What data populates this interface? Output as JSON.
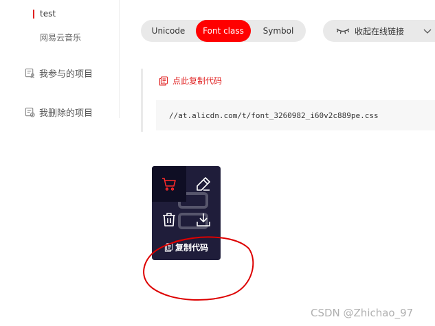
{
  "sidebar": {
    "items": [
      {
        "label": "test"
      },
      {
        "label": "网易云音乐"
      },
      {
        "label": "我参与的项目"
      },
      {
        "label": "我删除的项目"
      }
    ]
  },
  "tabs": [
    {
      "label": "Unicode",
      "active": false
    },
    {
      "label": "Font class",
      "active": true
    },
    {
      "label": "Symbol",
      "active": false
    }
  ],
  "collapse": {
    "label": "收起在线链接"
  },
  "code": {
    "copy_label": "点此复制代码",
    "url": "//at.alicdn.com/t/font_3260982_i60v2c889pe.css"
  },
  "popup": {
    "copy_label": "复制代码"
  },
  "watermark": "CSDN @Zhichao_97",
  "colors": {
    "accent": "#ff0000",
    "card_bg": "#1f1d3a",
    "pill_bg": "#e9e9e9"
  }
}
